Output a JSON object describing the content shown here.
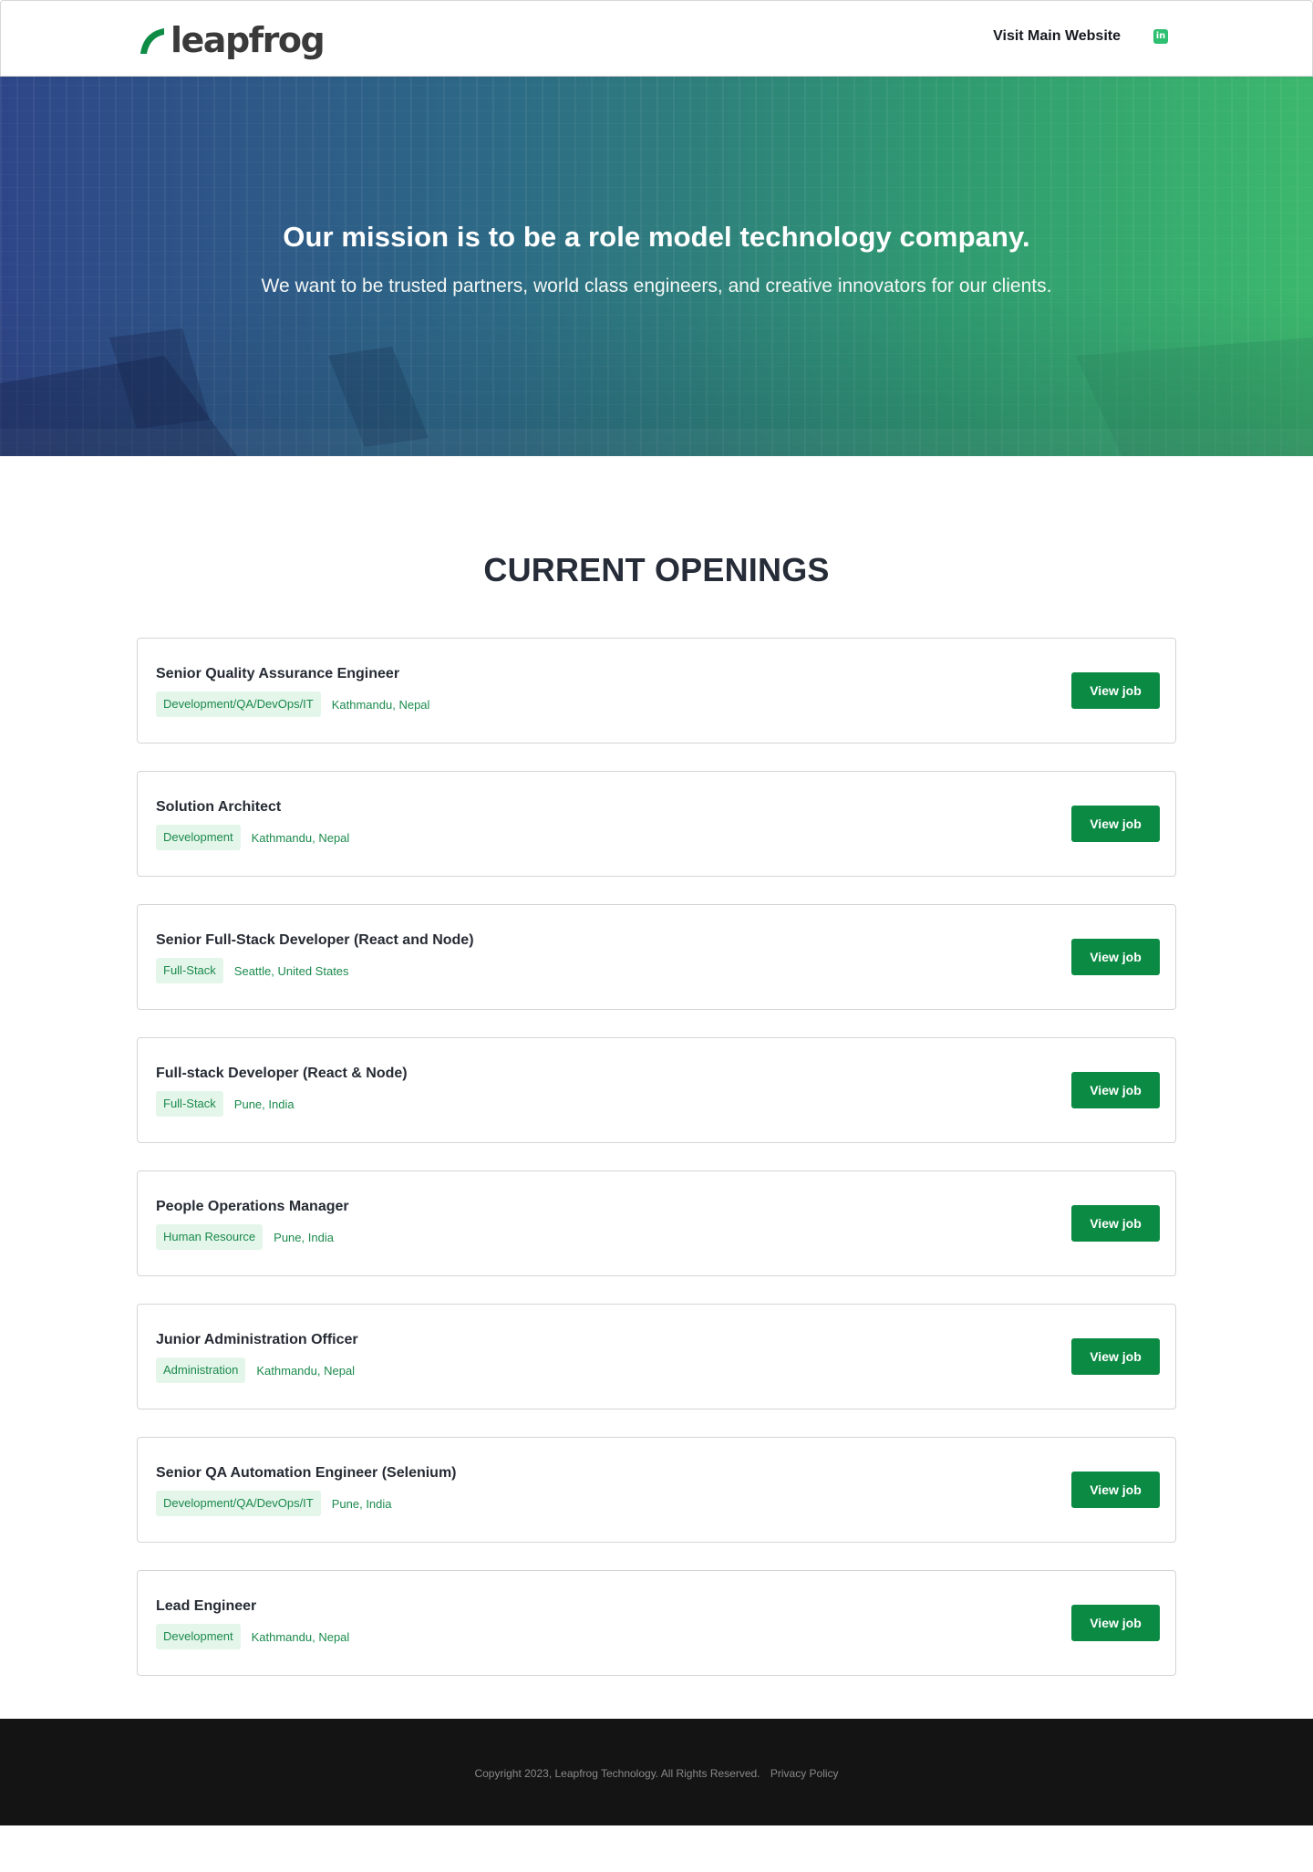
{
  "header": {
    "logo_text": "leapfrog",
    "nav_link": "Visit Main Website",
    "linkedin_icon_glyph": "in"
  },
  "hero": {
    "title": "Our mission is to be a role model technology company.",
    "subtitle": "We want to be trusted partners, world class engineers, and creative innovators for our clients."
  },
  "openings": {
    "heading": "CURRENT OPENINGS",
    "button_label": "View job",
    "jobs": [
      {
        "title": "Senior Quality Assurance Engineer",
        "category": "Development/QA/DevOps/IT",
        "location": "Kathmandu, Nepal"
      },
      {
        "title": "Solution Architect",
        "category": "Development",
        "location": "Kathmandu, Nepal"
      },
      {
        "title": "Senior Full-Stack Developer (React and Node)",
        "category": "Full-Stack",
        "location": "Seattle, United States"
      },
      {
        "title": "Full-stack Developer (React & Node)",
        "category": "Full-Stack",
        "location": "Pune, India"
      },
      {
        "title": "People Operations Manager",
        "category": "Human Resource",
        "location": "Pune, India"
      },
      {
        "title": "Junior Administration Officer",
        "category": "Administration",
        "location": "Kathmandu, Nepal"
      },
      {
        "title": "Senior QA Automation Engineer (Selenium)",
        "category": "Development/QA/DevOps/IT",
        "location": "Pune, India"
      },
      {
        "title": "Lead Engineer",
        "category": "Development",
        "location": "Kathmandu, Nepal"
      }
    ]
  },
  "footer": {
    "copyright": "Copyright 2023, Leapfrog Technology. All Rights Reserved.",
    "privacy": "Privacy Policy"
  },
  "colors": {
    "brand_green": "#0b8a43",
    "tag_background": "#e4f5ea",
    "tag_text": "#1b8a4c",
    "hero_gradient_start": "#2e4688",
    "hero_gradient_end": "#3cb86d",
    "footer_background": "#141414"
  }
}
